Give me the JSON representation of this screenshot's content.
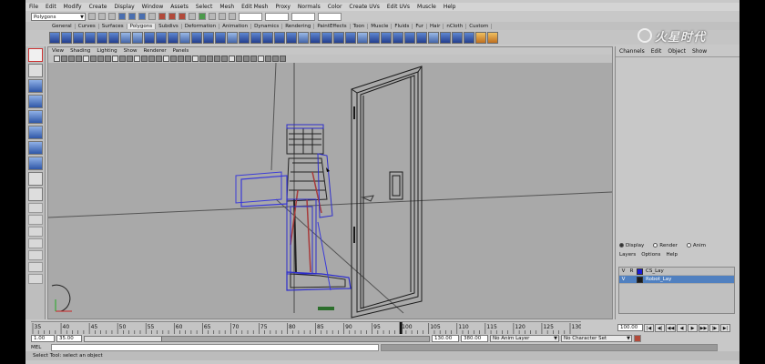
{
  "menubar": {
    "items": [
      "File",
      "Edit",
      "Modify",
      "Create",
      "Display",
      "Window",
      "Assets",
      "Select",
      "Mesh",
      "Edit Mesh",
      "Proxy",
      "Normals",
      "Color",
      "Create UVs",
      "Edit UVs",
      "Muscle",
      "Help"
    ]
  },
  "statusline": {
    "mode": "Polygons"
  },
  "shelf": {
    "tabs": [
      "General",
      "Curves",
      "Surfaces",
      "Polygons",
      "Subdivs",
      "Deformation",
      "Animation",
      "Dynamics",
      "Rendering",
      "PaintEffects",
      "Toon",
      "Muscle",
      "Fluids",
      "Fur",
      "Hair",
      "nCloth",
      "Custom"
    ],
    "active_tab": "Polygons"
  },
  "panel": {
    "menu": [
      "View",
      "Shading",
      "Lighting",
      "Show",
      "Renderer",
      "Panels"
    ]
  },
  "channelbox": {
    "menu": [
      "Channels",
      "Edit",
      "Object",
      "Show"
    ]
  },
  "layers": {
    "modes": [
      "Display",
      "Render",
      "Anim"
    ],
    "menu": [
      "Layers",
      "Options",
      "Help"
    ],
    "rows": [
      {
        "v": "V",
        "r": "R",
        "name": "CS_Lay",
        "color": "#1a1ad8",
        "selected": false
      },
      {
        "v": "V",
        "r": "",
        "name": "Robot_Lay",
        "color": "#1a1a1a",
        "selected": true
      }
    ]
  },
  "timeline": {
    "ticks": [
      "35",
      "40",
      "45",
      "50",
      "55",
      "60",
      "65",
      "70",
      "75",
      "80",
      "85",
      "90",
      "95",
      "100",
      "105",
      "110",
      "115",
      "120",
      "125",
      "130"
    ],
    "current_frame": "100.00"
  },
  "range": {
    "start": "1.00",
    "inner_start": "35.00",
    "inner_end": "130.00",
    "end": "380.00",
    "anim_layer": "No Anim Layer",
    "character_set": "No Character Set"
  },
  "cmdline": {
    "label": "MEL"
  },
  "helpline": {
    "text": "Select Tool: select an object"
  },
  "logo": {
    "text": "火星时代"
  }
}
